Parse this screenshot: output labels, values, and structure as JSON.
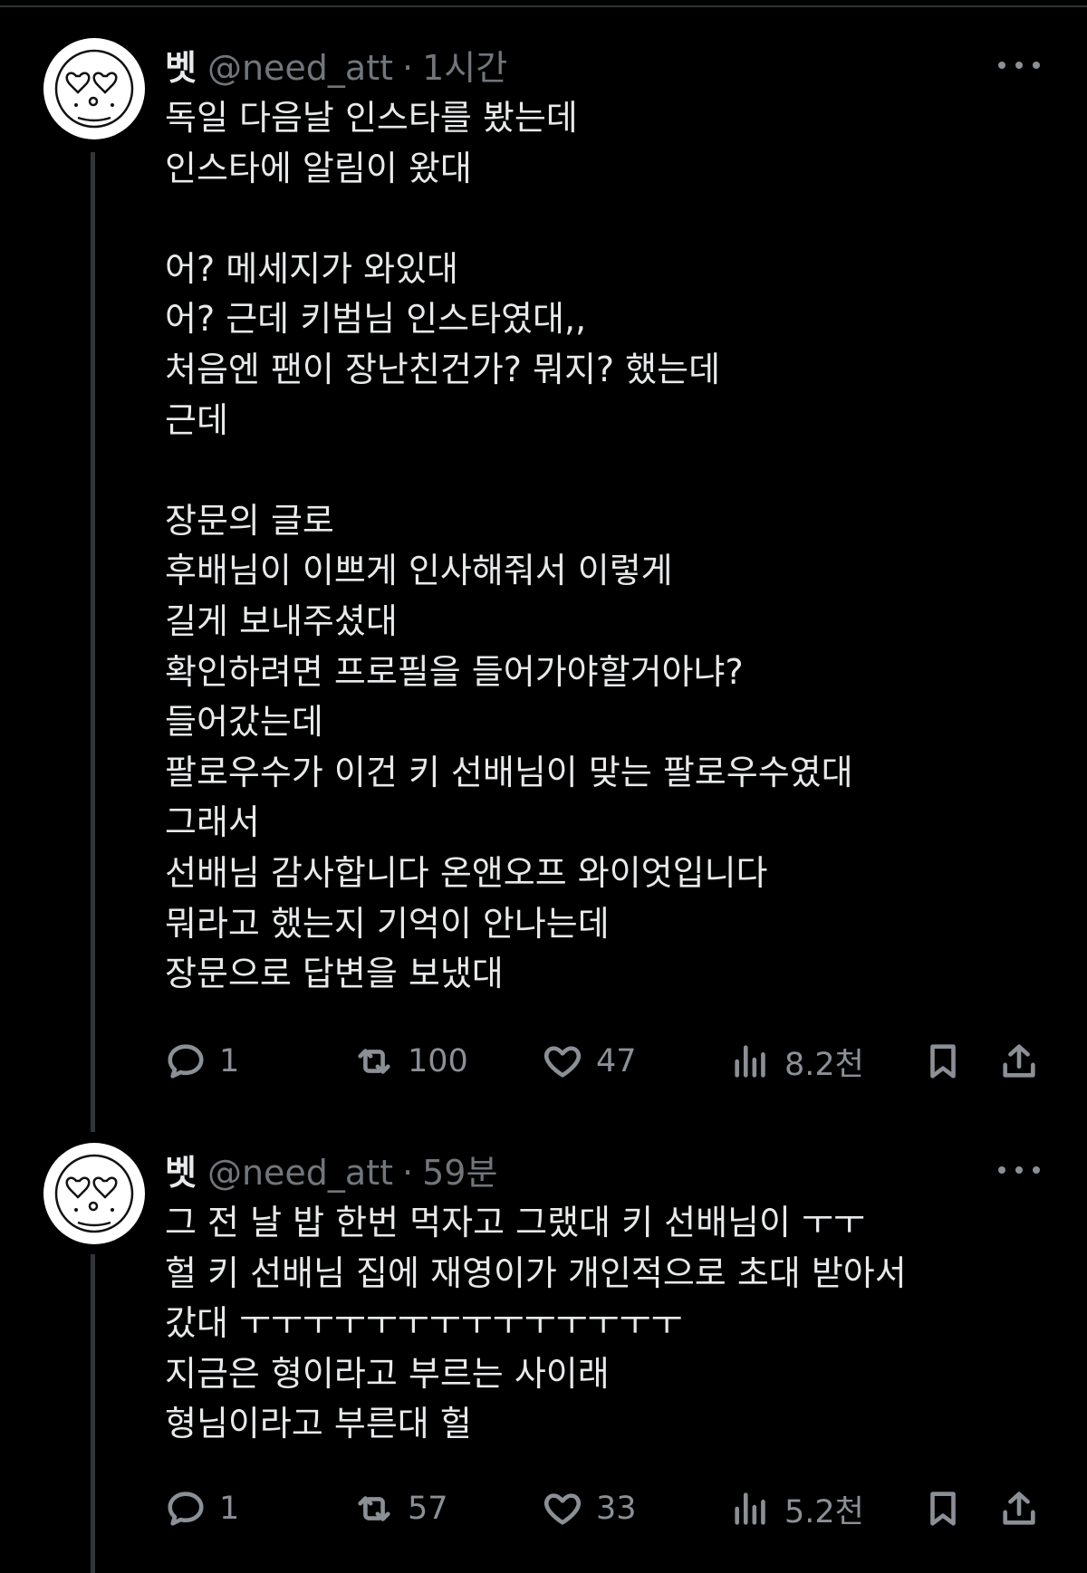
{
  "tweets": [
    {
      "name": "벳",
      "handle": "@need_att",
      "dot": "·",
      "time": "1시간",
      "lines": [
        "독일 다음날 인스타를 봤는데",
        "인스타에 알림이 왔대",
        "",
        "어? 메세지가 와있대",
        "어? 근데 키범님 인스타였대,,",
        "처음엔 팬이 장난친건가? 뭐지? 했는데",
        "근데",
        "",
        "장문의 글로",
        "후배님이 이쁘게 인사해줘서 이렇게",
        "길게 보내주셨대",
        "확인하려면 프로필을 들어가야할거아냐?",
        "들어갔는데",
        "팔로우수가 이건 키 선배님이 맞는 팔로우수였대",
        "그래서",
        "선배님 감사합니다 온앤오프 와이엇입니다",
        "뭐라고 했는지 기억이 안나는데",
        "장문으로 답변을 보냈대"
      ],
      "replies": "1",
      "reposts": "100",
      "likes": "47",
      "views": "8.2천"
    },
    {
      "name": "벳",
      "handle": "@need_att",
      "dot": "·",
      "time": "59분",
      "lines": [
        "그 전 날 밥 한번 먹자고 그랬대 키 선배님이 ㅜㅜ",
        "헐 키 선배님 집에 재영이가 개인적으로 초대 받아서",
        "갔대 ㅜㅜㅜㅜㅜㅜㅜㅜㅜㅜㅜㅜㅜㅜ",
        "지금은 형이라고 부르는 사이래",
        "형님이라고 부른대 헐"
      ],
      "replies": "1",
      "reposts": "57",
      "likes": "33",
      "views": "5.2천"
    }
  ],
  "icons": [
    "reply-icon",
    "repost-icon",
    "like-icon",
    "views-icon",
    "bookmark-icon",
    "share-icon",
    "more-icon"
  ],
  "colors": {
    "background": "#000000",
    "text": "#e7e9ea",
    "muted": "#71767b",
    "thread_line": "#333639"
  }
}
